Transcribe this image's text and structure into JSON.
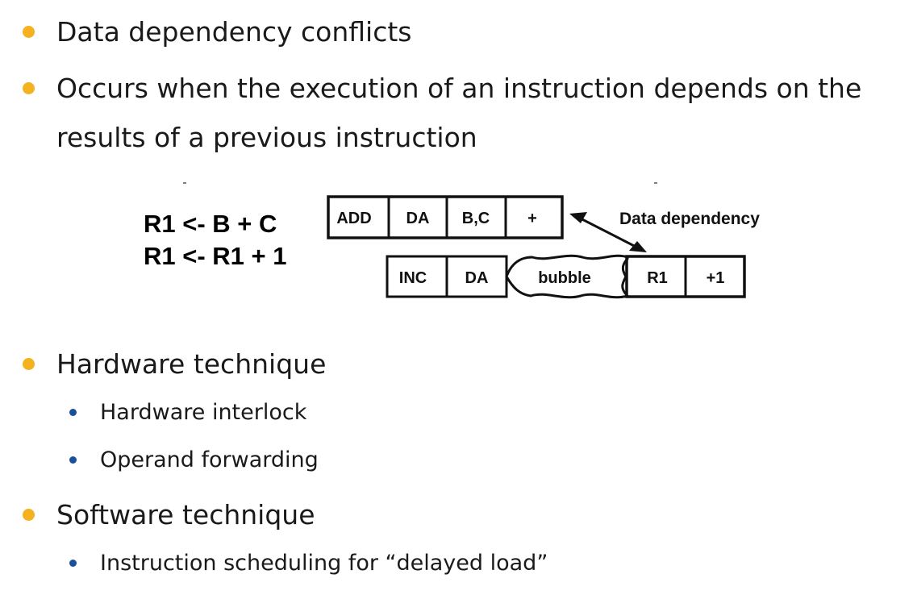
{
  "bullets": [
    {
      "text": "Data dependency conflicts"
    },
    {
      "text_line1": "Occurs when the execution of an instruction depends on the",
      "text_line2": "results of a previous instruction"
    },
    {
      "text": "Hardware technique",
      "sub": [
        "Hardware interlock",
        "Operand forwarding"
      ]
    },
    {
      "text": "Software technique",
      "sub": [
        "Instruction scheduling for “delayed load”"
      ]
    }
  ],
  "diagram": {
    "equations": [
      "R1 <- B + C",
      "R1 <- R1 + 1"
    ],
    "row1": [
      "ADD",
      "DA",
      "B,C",
      "+"
    ],
    "row2_before": [
      "INC",
      "DA"
    ],
    "bubble": "bubble",
    "row2_after": [
      "R1",
      "+1"
    ],
    "annotation": "Data dependency"
  },
  "colors": {
    "primary_bullet": "#f4b120",
    "secondary_bullet": "#1b4f9c"
  }
}
